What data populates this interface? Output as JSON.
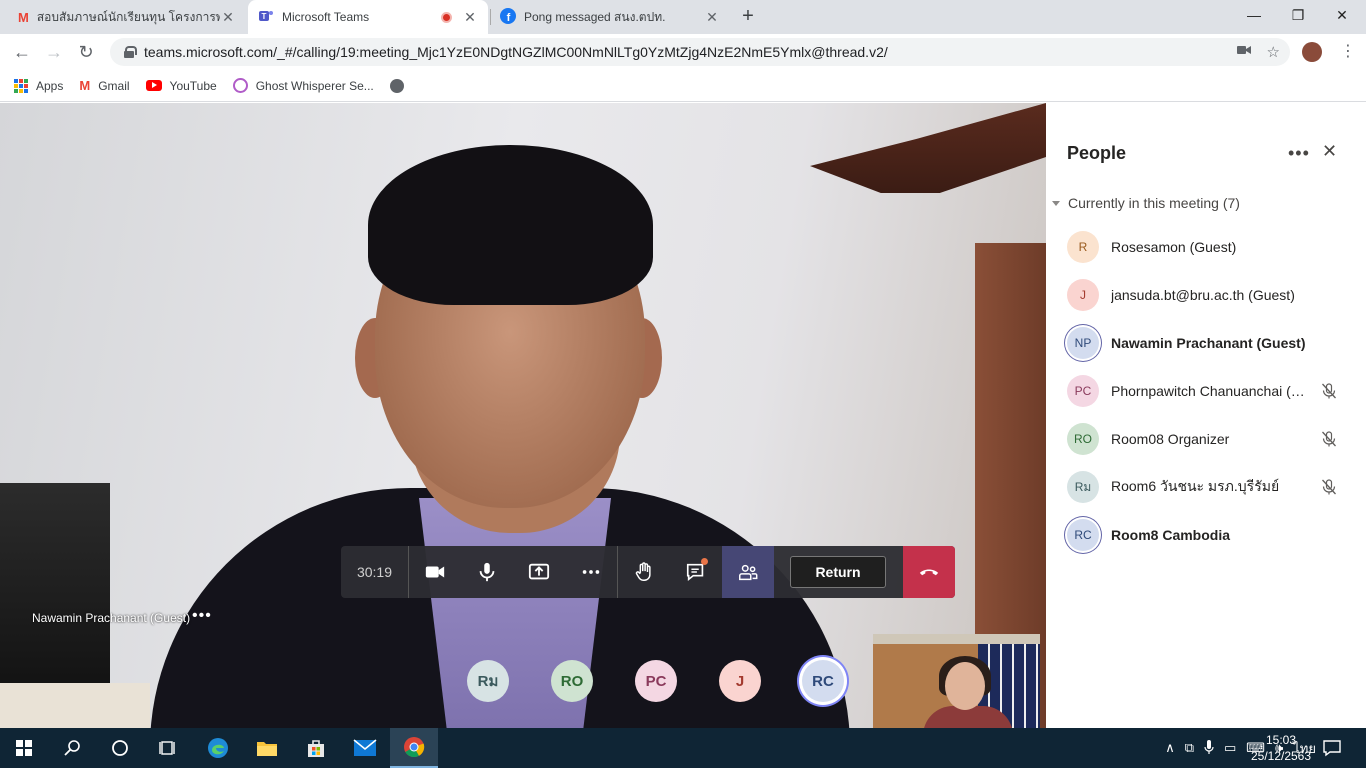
{
  "browser": {
    "tabs": [
      {
        "label": "สอบสัมภาษณ์นักเรียนทุน โครงการพระ",
        "icon": "gmail-icon",
        "active": false
      },
      {
        "label": "Microsoft Teams",
        "icon": "teams-icon",
        "active": true
      },
      {
        "label": "Pong messaged สนง.ตปท.",
        "icon": "facebook-icon",
        "active": false
      }
    ],
    "url": "teams.microsoft.com/_#/calling/19:meeting_Mjc1YzE0NDgtNGZlMC00NmNlLTg0YzMtZjg4NzE2NmE5Ymlx@thread.v2/",
    "bookmarks": [
      {
        "label": "Apps",
        "icon": "apps-icon"
      },
      {
        "label": "Gmail",
        "icon": "gmail-icon"
      },
      {
        "label": "YouTube",
        "icon": "youtube-icon"
      },
      {
        "label": "Ghost Whisperer Se...",
        "icon": "ghost-icon"
      }
    ]
  },
  "call": {
    "speaker_name": "Nawamin Prachanant (Guest)",
    "timer": "30:19",
    "return_label": "Return",
    "avatars": [
      {
        "initials": "Rม",
        "bg": "#d7e3e4",
        "fg": "#3b5a5d",
        "ring": false
      },
      {
        "initials": "RO",
        "bg": "#cfe3d1",
        "fg": "#2e6b35",
        "ring": false
      },
      {
        "initials": "PC",
        "bg": "#f4d7e3",
        "fg": "#8a3a5c",
        "ring": false
      },
      {
        "initials": "J",
        "bg": "#fad4d0",
        "fg": "#a33a2e",
        "ring": false
      },
      {
        "initials": "RC",
        "bg": "#d3dcef",
        "fg": "#2f4a7a",
        "ring": true
      }
    ]
  },
  "people_panel": {
    "title": "People",
    "section": "Currently in this meeting (7)",
    "participants": [
      {
        "initials": "R",
        "name": "Rosesamon (Guest)",
        "bg": "#fbe3cf",
        "fg": "#9a5a1c",
        "bold": false,
        "muted": false,
        "ring": false
      },
      {
        "initials": "J",
        "name": "jansuda.bt@bru.ac.th (Guest)",
        "bg": "#fad4d0",
        "fg": "#a33a2e",
        "bold": false,
        "muted": false,
        "ring": false
      },
      {
        "initials": "NP",
        "name": "Nawamin Prachanant (Guest)",
        "bg": "#d3dcef",
        "fg": "#2f4a7a",
        "bold": true,
        "muted": false,
        "ring": true
      },
      {
        "initials": "PC",
        "name": "Phornpawitch Chanuanchai (Guest)",
        "bg": "#f4d7e3",
        "fg": "#8a3a5c",
        "bold": false,
        "muted": true,
        "ring": false
      },
      {
        "initials": "RO",
        "name": "Room08 Organizer",
        "bg": "#cfe3d1",
        "fg": "#2e6b35",
        "bold": false,
        "muted": true,
        "ring": false
      },
      {
        "initials": "Rม",
        "name": "Room6 วันชนะ มรภ.บุรีรัมย์",
        "bg": "#d7e3e4",
        "fg": "#3b5a5d",
        "bold": false,
        "muted": true,
        "ring": false
      },
      {
        "initials": "RC",
        "name": "Room8 Cambodia",
        "bg": "#d3dcef",
        "fg": "#2f4a7a",
        "bold": true,
        "muted": false,
        "ring": true
      }
    ]
  },
  "taskbar": {
    "language": "ไทย",
    "time": "15:03",
    "date": "25/12/2563"
  }
}
